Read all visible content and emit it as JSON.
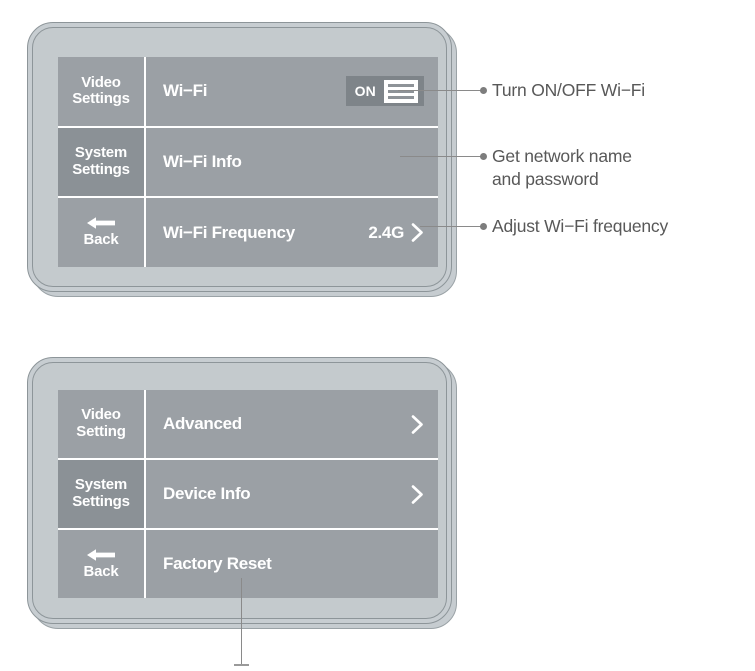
{
  "devices": [
    {
      "name": "wifi-settings-screen",
      "tabs": [
        {
          "id": "video-settings",
          "lines": [
            "Video",
            "Settings"
          ],
          "selected": false
        },
        {
          "id": "system-settings",
          "lines": [
            "System",
            "Settings"
          ],
          "selected": true
        },
        {
          "id": "back",
          "lines": [
            "Back"
          ],
          "selected": false,
          "icon": "back-arrow-icon"
        }
      ],
      "rows": [
        {
          "id": "wi-fi",
          "label": "Wi−Fi",
          "control": "toggle",
          "toggle_state": "ON",
          "value": "",
          "chevron": false
        },
        {
          "id": "wi-fi-info",
          "label": "Wi−Fi Info",
          "control": "none",
          "value": "",
          "chevron": false
        },
        {
          "id": "wi-fi-frequency",
          "label": "Wi−Fi Frequency",
          "control": "value",
          "value": "2.4G",
          "chevron": true
        }
      ]
    },
    {
      "name": "system-settings-screen",
      "tabs": [
        {
          "id": "video-setting",
          "lines": [
            "Video",
            "Setting"
          ],
          "selected": false
        },
        {
          "id": "system-settings",
          "lines": [
            "System",
            "Settings"
          ],
          "selected": true
        },
        {
          "id": "back",
          "lines": [
            "Back"
          ],
          "selected": false,
          "icon": "back-arrow-icon"
        }
      ],
      "rows": [
        {
          "id": "advanced",
          "label": "Advanced",
          "control": "none",
          "value": "",
          "chevron": true
        },
        {
          "id": "device-info",
          "label": "Device Info",
          "control": "none",
          "value": "",
          "chevron": true
        },
        {
          "id": "factory-reset",
          "label": "Factory Reset",
          "control": "none",
          "value": "",
          "chevron": false
        }
      ]
    }
  ],
  "callouts": [
    {
      "id": "callout-wifi-toggle",
      "text": "Turn ON/OFF Wi−Fi"
    },
    {
      "id": "callout-wifi-info",
      "text": "Get network name\nand password"
    },
    {
      "id": "callout-wifi-frequency",
      "text": "Adjust Wi−Fi frequency"
    }
  ],
  "colors": {
    "bezel": "#c7cdd1",
    "bezel_outline": "#8d9599",
    "row": "#9ba0a5",
    "tab_selected": "#8b9196",
    "toggle_track": "#7e8489",
    "divider": "#ffffff",
    "callout_text": "#585858",
    "leader_line": "#8a8a8a"
  }
}
